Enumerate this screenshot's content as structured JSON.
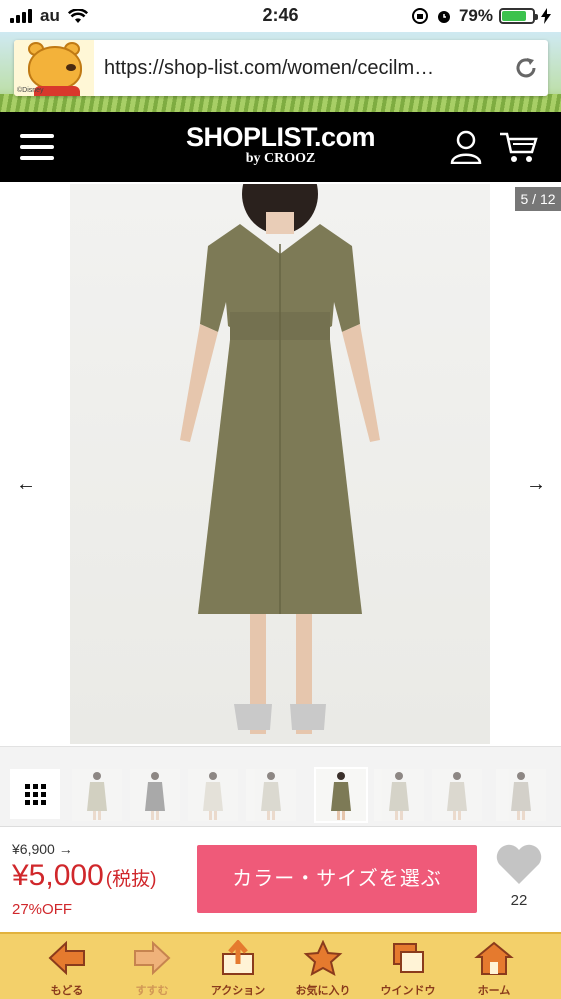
{
  "status_bar": {
    "carrier": "au",
    "time": "2:46",
    "battery": "79%",
    "battery_level": 0.79
  },
  "browser": {
    "url": "https://shop-list.com/women/cecilm…",
    "logo_credit": "©Disney"
  },
  "header": {
    "logo": "SHOPLIST.com",
    "logo_sub": "by CROOZ"
  },
  "gallery": {
    "counter": "5 / 12",
    "prev": "←",
    "next": "→",
    "active_thumb": 5
  },
  "product": {
    "old_price": "¥6,900 →",
    "price": "¥5,000",
    "tax_label": "(税抜)",
    "discount": "27%OFF",
    "cta_label": "カラー・サイズを選ぶ",
    "favorites": "22"
  },
  "toolbar": [
    {
      "label": "もどる",
      "icon": "back-arrow-icon"
    },
    {
      "label": "すすむ",
      "icon": "forward-arrow-icon"
    },
    {
      "label": "アクション",
      "icon": "share-icon"
    },
    {
      "label": "お気に入り",
      "icon": "star-icon"
    },
    {
      "label": "ウインドウ",
      "icon": "windows-icon"
    },
    {
      "label": "ホーム",
      "icon": "home-icon"
    }
  ],
  "colors": {
    "accent": "#ef5a79",
    "price": "#d0272b",
    "nav": "#000000",
    "toolbar": "#f3d06a"
  }
}
